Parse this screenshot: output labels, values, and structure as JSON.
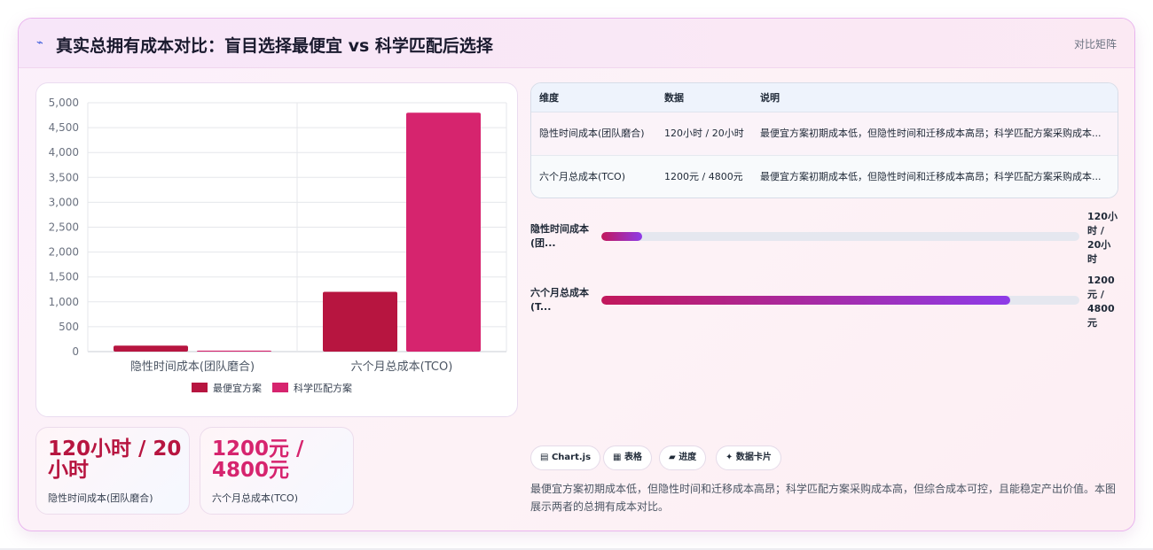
{
  "header": {
    "icon": "lightning-icon",
    "icon_glyph": "⌁",
    "title": "真实总拥有成本对比：盲目选择最便宜 vs 科学匹配后选择",
    "right_link": "对比矩阵"
  },
  "chart_data": {
    "type": "bar",
    "categories": [
      "隐性时间成本(团队磨合)",
      "六个月总成本(TCO)"
    ],
    "series": [
      {
        "name": "最便宜方案",
        "values": [
          120,
          1200
        ],
        "color": "#b71540"
      },
      {
        "name": "科学匹配方案",
        "values": [
          20,
          4800
        ],
        "color": "#d6246e"
      }
    ],
    "ylim": [
      0,
      5000
    ],
    "yticks": [
      0,
      500,
      1000,
      1500,
      2000,
      2500,
      3000,
      3500,
      4000,
      4500,
      5000
    ],
    "ytick_labels": [
      "0",
      "500",
      "1,000",
      "1,500",
      "2,000",
      "2,500",
      "3,000",
      "3,500",
      "4,000",
      "4,500",
      "5,000"
    ],
    "grid": true,
    "legend_position": "bottom"
  },
  "stats": [
    {
      "value": "120小时 / 20小时",
      "label": "隐性时间成本(团队磨合)"
    },
    {
      "value": "1200元 / 4800元",
      "label": "六个月总成本(TCO)"
    }
  ],
  "table": {
    "headers": [
      "维度",
      "数据",
      "说明"
    ],
    "rows": [
      [
        "隐性时间成本(团队磨合)",
        "120小时 / 20小时",
        "最便宜方案初期成本低，但隐性时间和迁移成本高昂；科学匹配方案采购成本..."
      ],
      [
        "六个月总成本(TCO)",
        "1200元 / 4800元",
        "最便宜方案初期成本低，但隐性时间和迁移成本高昂；科学匹配方案采购成本..."
      ]
    ]
  },
  "progress": [
    {
      "label": "隐性时间成本(团...",
      "value": "120小时 / 20小时",
      "fraction": 0.085
    },
    {
      "label": "六个月总成本(T...",
      "value": "1200元 / 4800元",
      "fraction": 0.855
    }
  ],
  "chips": [
    {
      "icon": "chart-icon",
      "glyph": "▤",
      "label": "Chart.js"
    },
    {
      "icon": "table-icon",
      "glyph": "▦",
      "label": "表格"
    },
    {
      "icon": "progress-icon",
      "glyph": "▰",
      "label": "进度"
    },
    {
      "icon": "sparkle-icon",
      "glyph": "✦",
      "label": "数据卡片"
    }
  ],
  "summary": "最便宜方案初期成本低，但隐性时间和迁移成本高昂；科学匹配方案采购成本高，但综合成本可控，且能稳定产出价值。本图展示两者的总拥有成本对比。"
}
